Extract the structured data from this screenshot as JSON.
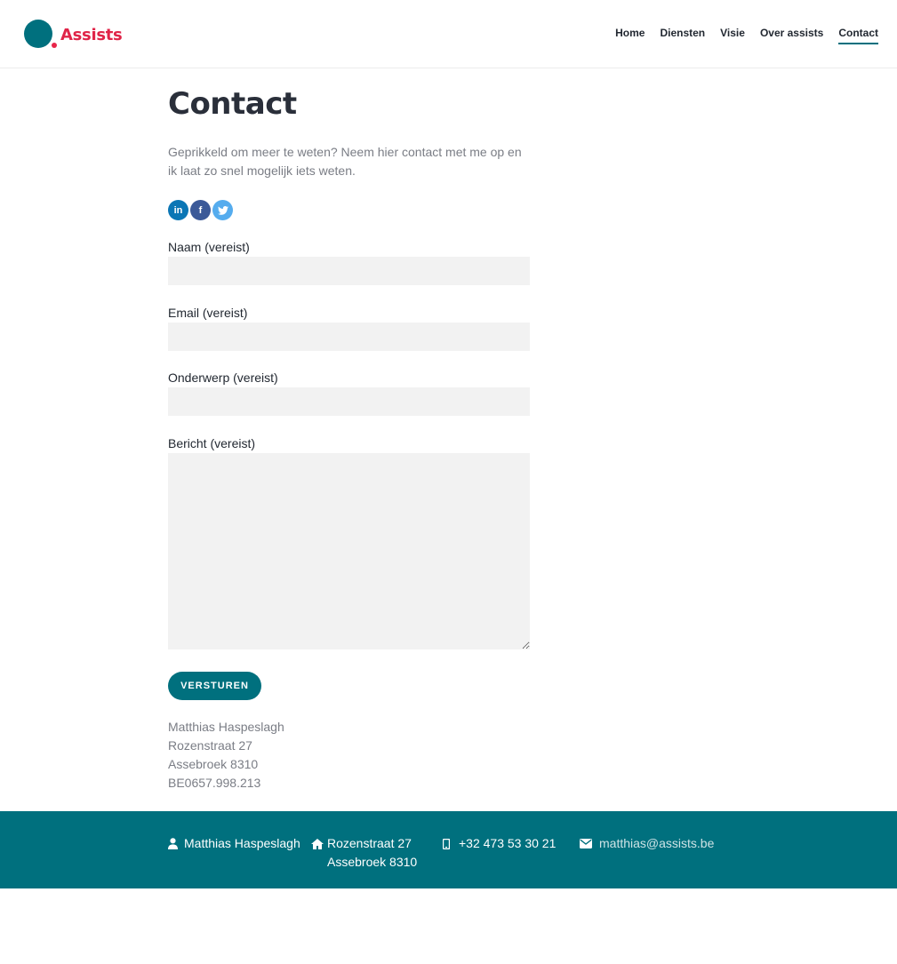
{
  "brand": {
    "name": "Assists",
    "primary_color": "#00707e",
    "accent_color": "#e02448"
  },
  "nav": {
    "items": [
      {
        "label": "Home"
      },
      {
        "label": "Diensten"
      },
      {
        "label": "Visie"
      },
      {
        "label": "Over assists"
      },
      {
        "label": "Contact"
      }
    ],
    "active": "Contact"
  },
  "page": {
    "title": "Contact",
    "intro": "Geprikkeld om meer te weten? Neem hier contact met me op en ik laat zo snel mogelijk iets weten."
  },
  "socials": [
    {
      "icon": "linkedin-icon",
      "glyph": "in"
    },
    {
      "icon": "facebook-icon",
      "glyph": "f"
    },
    {
      "icon": "twitter-icon",
      "glyph": "t"
    }
  ],
  "form": {
    "name_label": "Naam (vereist)",
    "name_value": "",
    "email_label": "Email (vereist)",
    "email_value": "",
    "subject_label": "Onderwerp (vereist)",
    "subject_value": "",
    "message_label": "Bericht (vereist)",
    "message_value": "",
    "submit_label": "VERSTUREN"
  },
  "address": {
    "name": "Matthias Haspeslagh",
    "street": "Rozenstraat 27",
    "city": "Assebroek 8310",
    "vat": "BE0657.998.213"
  },
  "footer": {
    "name": "Matthias Haspeslagh",
    "street": "Rozenstraat 27",
    "city": "Assebroek 8310",
    "phone": "+32 473 53 30 21",
    "email": "matthias@assists.be"
  }
}
